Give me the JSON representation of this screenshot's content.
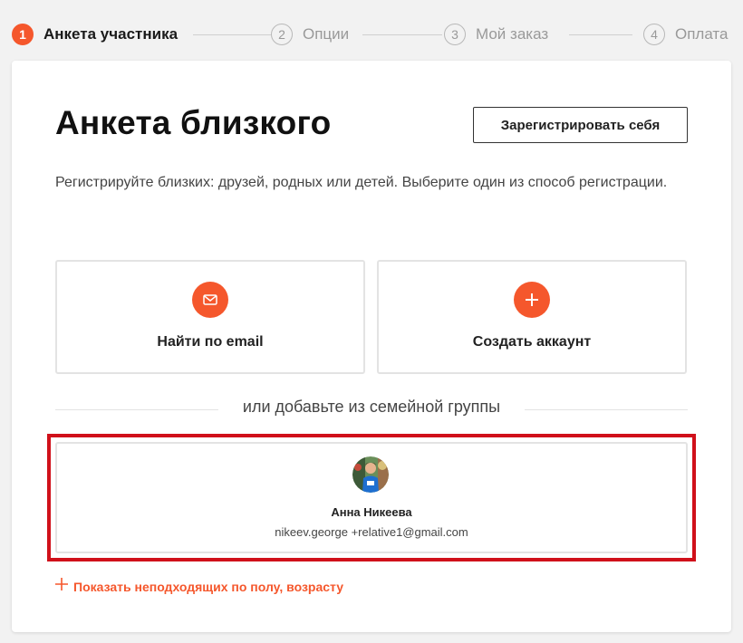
{
  "stepper": {
    "steps": [
      {
        "number": "1",
        "label": "Анкета участника"
      },
      {
        "number": "2",
        "label": "Опции"
      },
      {
        "number": "3",
        "label": "Мой заказ"
      },
      {
        "number": "4",
        "label": "Оплата"
      }
    ]
  },
  "card": {
    "title": "Анкета близкого",
    "register_self_label": "Зарегистрировать себя",
    "description": "Регистрируйте близких: друзей, родных или детей. Выберите один из способ регистрации.",
    "options": {
      "email_label": "Найти по email",
      "create_label": "Создать аккаунт"
    },
    "divider_text": "или добавьте из семейной группы",
    "family_member": {
      "name": "Анна Никеева",
      "email": "nikeev.george +relative1@gmail.com"
    },
    "show_more_label": "Показать неподходящих по полу, возрасту"
  },
  "colors": {
    "accent": "#f5572c",
    "highlight": "#d0101a"
  },
  "icons": {
    "email": "envelope-icon",
    "create": "plus-icon",
    "show_more": "plus-icon"
  }
}
